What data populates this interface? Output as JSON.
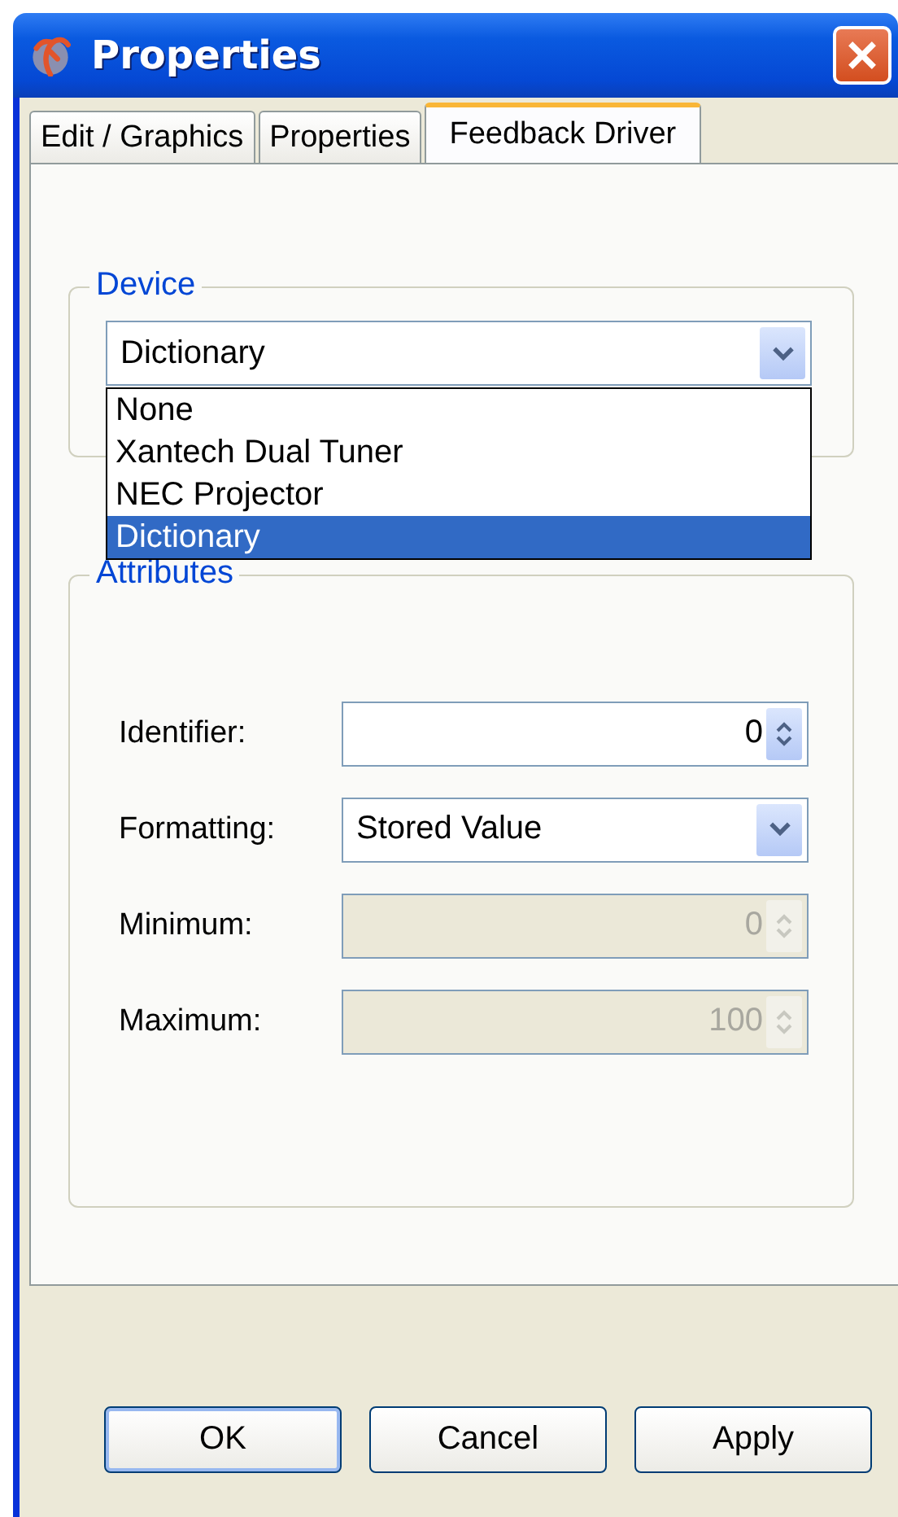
{
  "window": {
    "title": "Properties"
  },
  "tabs": [
    {
      "label": "Edit / Graphics",
      "selected": false
    },
    {
      "label": "Properties",
      "selected": false
    },
    {
      "label": "Feedback Driver",
      "selected": true
    }
  ],
  "device": {
    "label": "Device",
    "value": "Dictionary",
    "expanded": true,
    "options": [
      {
        "label": "None",
        "selected": false
      },
      {
        "label": "Xantech Dual Tuner",
        "selected": false
      },
      {
        "label": "NEC Projector",
        "selected": false
      },
      {
        "label": "Dictionary",
        "selected": true
      }
    ]
  },
  "attributes": {
    "label": "Attributes",
    "fields": [
      {
        "kind": "spin",
        "label": "Identifier:",
        "value": "0",
        "disabled": false
      },
      {
        "kind": "combo",
        "label": "Formatting:",
        "value": "Stored Value",
        "disabled": false
      },
      {
        "kind": "spin",
        "label": "Minimum:",
        "value": "0",
        "disabled": true
      },
      {
        "kind": "spin",
        "label": "Maximum:",
        "value": "100",
        "disabled": true
      }
    ]
  },
  "buttons": [
    {
      "label": "OK",
      "default": true
    },
    {
      "label": "Cancel",
      "default": false
    },
    {
      "label": "Apply",
      "default": false
    }
  ]
}
